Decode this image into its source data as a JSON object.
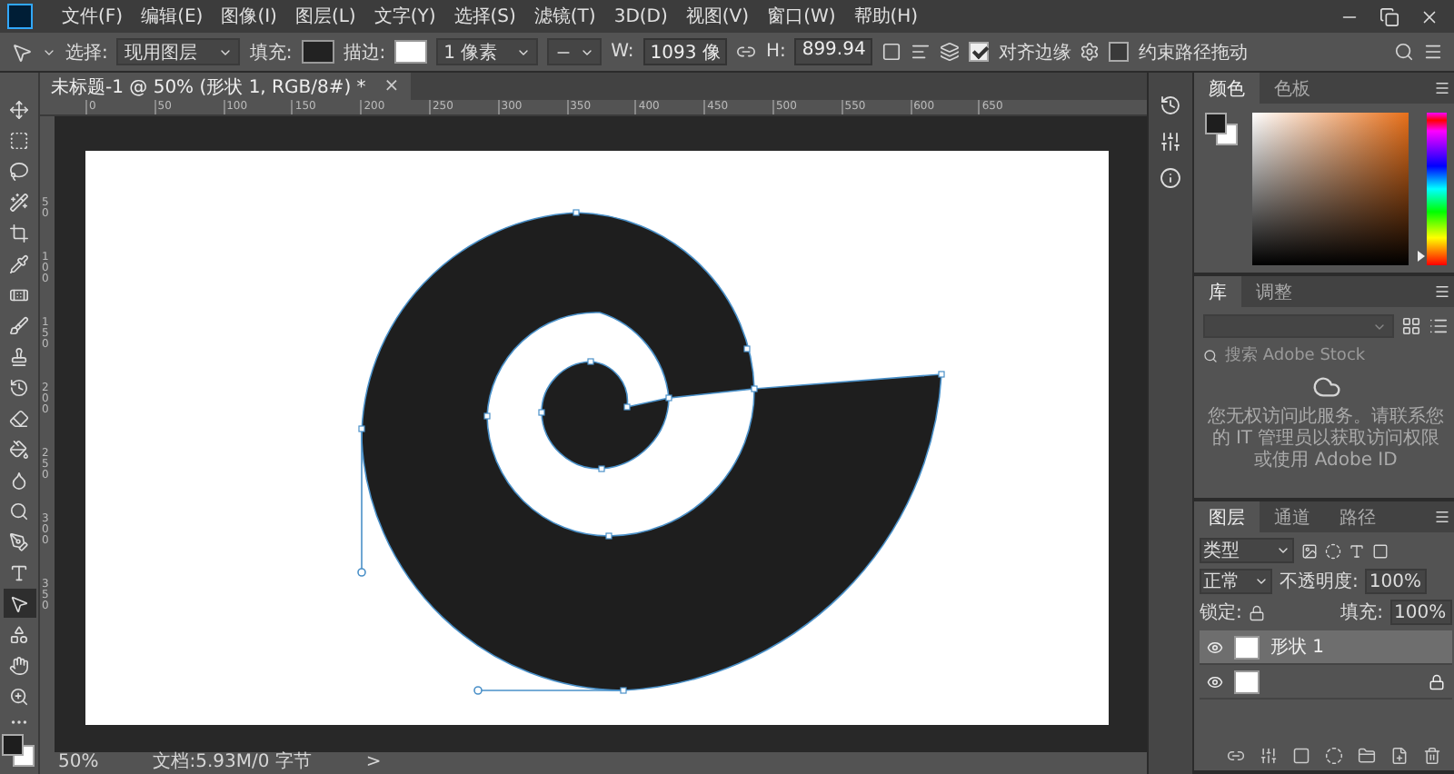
{
  "menu": {
    "items": [
      "文件(F)",
      "编辑(E)",
      "图像(I)",
      "图层(L)",
      "文字(Y)",
      "选择(S)",
      "滤镜(T)",
      "3D(D)",
      "视图(V)",
      "窗口(W)",
      "帮助(H)"
    ]
  },
  "options": {
    "select_label": "选择:",
    "select_value": "现用图层",
    "fill_label": "填充:",
    "stroke_label": "描边:",
    "stroke_width": "1 像素",
    "w_label": "W:",
    "w_value": "1093 像",
    "h_label": "H:",
    "h_value": "899.94",
    "align_edges": {
      "label": "对齐边缘",
      "checked": true
    },
    "constrain": {
      "label": "约束路径拖动",
      "checked": false
    }
  },
  "tools": [
    {
      "selected": false
    },
    {
      "selected": false
    },
    {
      "selected": false
    },
    {
      "selected": false
    },
    {
      "selected": false
    },
    {
      "selected": false
    },
    {
      "selected": false
    },
    {
      "selected": false
    },
    {
      "selected": false
    },
    {
      "selected": false
    },
    {
      "selected": false
    },
    {
      "selected": false
    },
    {
      "selected": false
    },
    {
      "selected": false
    },
    {
      "selected": false
    },
    {
      "selected": false
    },
    {
      "selected": true
    },
    {
      "selected": false
    },
    {
      "selected": false
    },
    {
      "selected": false
    }
  ],
  "document_tab": {
    "title": "未标题-1 @ 50% (形状 1, RGB/8#) *",
    "close": "×"
  },
  "ruler": {
    "top_labels": [
      "0",
      "50",
      "100",
      "150",
      "200",
      "250",
      "300",
      "350",
      "400",
      "450",
      "500",
      "550",
      "600",
      "650"
    ],
    "left_labels": [
      "50",
      "100",
      "150",
      "200",
      "250",
      "300",
      "350"
    ]
  },
  "color_panel": {
    "tabs": [
      {
        "label": "颜色",
        "selected": true
      },
      {
        "label": "色板",
        "selected": false
      }
    ],
    "hue_slider": {
      "level": 0.06
    }
  },
  "library_panel": {
    "tabs": [
      {
        "label": "库",
        "selected": true
      },
      {
        "label": "调整",
        "selected": false
      }
    ],
    "search": {
      "placeholder": "搜索 Adobe Stock"
    },
    "message": "您无权访问此服务。请联系您的 IT 管理员以获取访问权限或使用 Adobe ID"
  },
  "layers_panel": {
    "tabs": [
      {
        "label": "图层",
        "selected": true
      },
      {
        "label": "通道",
        "selected": false
      },
      {
        "label": "路径",
        "selected": false
      }
    ],
    "filter": "类型",
    "blend_mode": "正常",
    "opacity_label": "不透明度:",
    "opacity": "100%",
    "lock_label": "锁定:",
    "fill_label": "填充:",
    "fill": "100%",
    "layers": [
      {
        "name": "形状 1",
        "selected": true,
        "locked": false
      },
      {
        "selected": false,
        "locked": true
      }
    ]
  },
  "status_bar": {
    "zoom": "50%",
    "doc_info": "文档:5.93M/0 字节",
    "arrow": ">"
  }
}
